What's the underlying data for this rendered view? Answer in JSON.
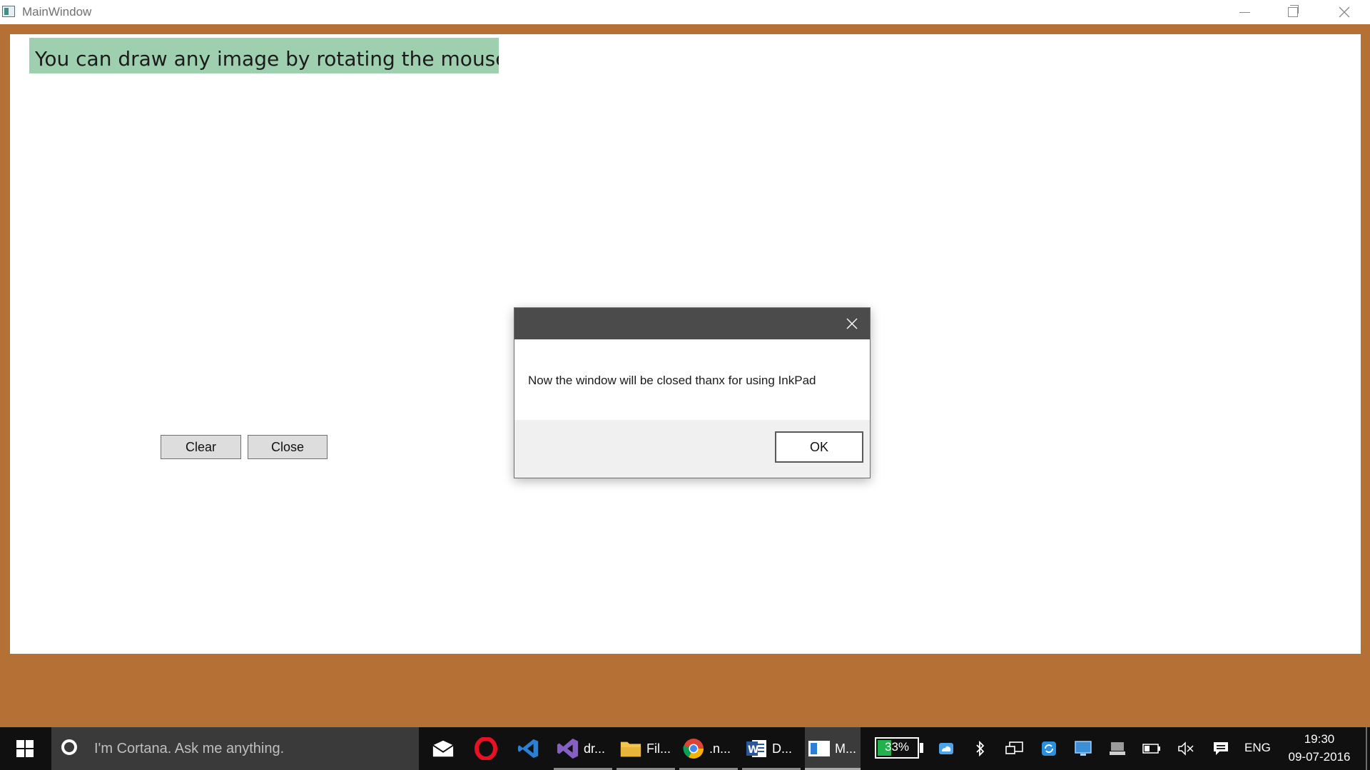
{
  "window": {
    "title": "MainWindow",
    "controls": [
      "minimize",
      "maximize",
      "close"
    ]
  },
  "canvas": {
    "banner_text": "You can draw any image by rotating the mouse",
    "clear_label": "Clear",
    "close_label": "Close"
  },
  "message_box": {
    "message": "Now the window will be closed thanx for using InkPad",
    "ok_label": "OK"
  },
  "taskbar": {
    "search_placeholder": "I'm Cortana. Ask me anything.",
    "apps": [
      {
        "name": "mail",
        "label": ""
      },
      {
        "name": "opera",
        "label": ""
      },
      {
        "name": "vscode",
        "label": ""
      },
      {
        "name": "visual-studio",
        "label": "dr..."
      },
      {
        "name": "file-explorer",
        "label": "Fil..."
      },
      {
        "name": "chrome",
        "label": ".n..."
      },
      {
        "name": "word",
        "label": "D..."
      },
      {
        "name": "mainwindow",
        "label": "M..."
      }
    ],
    "battery": "33%",
    "language": "ENG",
    "time": "19:30",
    "date": "09-07-2016"
  },
  "colors": {
    "desktop_background": "#b57035",
    "banner": "#9ed0b0",
    "msg_titlebar": "#4b4b4b",
    "taskbar": "#101010",
    "battery_fill": "#22b14c"
  }
}
